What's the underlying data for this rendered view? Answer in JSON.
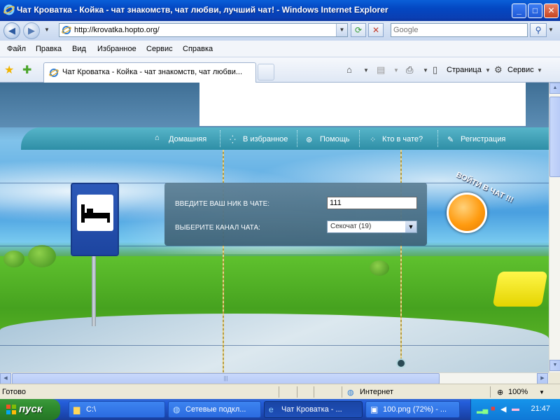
{
  "window": {
    "title": "Чат Кроватка - Койка - чат знакомств, чат любви, лучший чат! - Windows Internet Explorer",
    "minimize": "_",
    "maximize": "□",
    "close": "✕"
  },
  "address": {
    "url": "http://krovatka.hopto.org/",
    "search_placeholder": "Google"
  },
  "menu": [
    "Файл",
    "Правка",
    "Вид",
    "Избранное",
    "Сервис",
    "Справка"
  ],
  "tab": {
    "title": "Чат Кроватка - Койка - чат знакомств, чат любви..."
  },
  "toolbar": {
    "page_label": "Страница",
    "tools_label": "Сервис"
  },
  "site": {
    "nav": [
      "Домашняя",
      "В избранное",
      "Помощь",
      "Кто в чате?",
      "Регистрация"
    ],
    "nick_label": "ВВЕДИТЕ ВАШ НИК В ЧАТЕ:",
    "nick_value": "111",
    "channel_label": "ВЫБЕРИТЕ КАНАЛ ЧАТА:",
    "channel_value": "Секочат (19)",
    "enter_label": "ВОЙТИ В ЧАТ !!!"
  },
  "status": {
    "left": "Готово",
    "zone": "Интернет",
    "zoom": "100%"
  },
  "taskbar": {
    "start": "пуск",
    "tasks": [
      "C:\\",
      "Сетевые подкл...",
      "Чат Кроватка - ...",
      "100.png (72%) - ..."
    ],
    "time": "21:47"
  },
  "colors": {
    "titlebar": "#0347c2",
    "nav_bar": "#2e8ea6",
    "go_button": "#ff9b10",
    "taskbar": "#245edb",
    "start": "#2e8b2e"
  }
}
